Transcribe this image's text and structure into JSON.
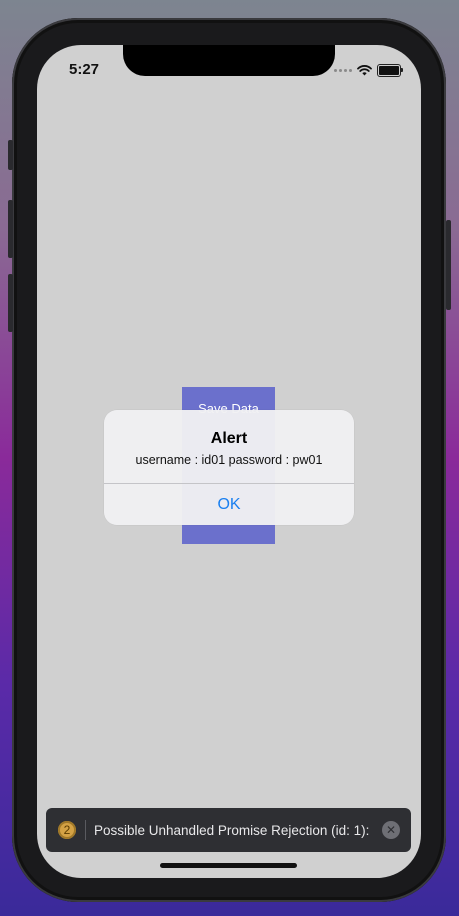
{
  "status_bar": {
    "time": "5:27"
  },
  "main": {
    "save_button_label": "Save Data"
  },
  "alert": {
    "title": "Alert",
    "message": "username : id01 password : pw01",
    "ok_label": "OK"
  },
  "toast": {
    "count": "2",
    "message": "Possible Unhandled Promise Rejection (id: 1):",
    "close_glyph": "✕"
  },
  "colors": {
    "button": "#6b70cc",
    "ok_text": "#1a7ff0",
    "toast_bg": "#2e2f33",
    "badge": "#d4a245"
  }
}
